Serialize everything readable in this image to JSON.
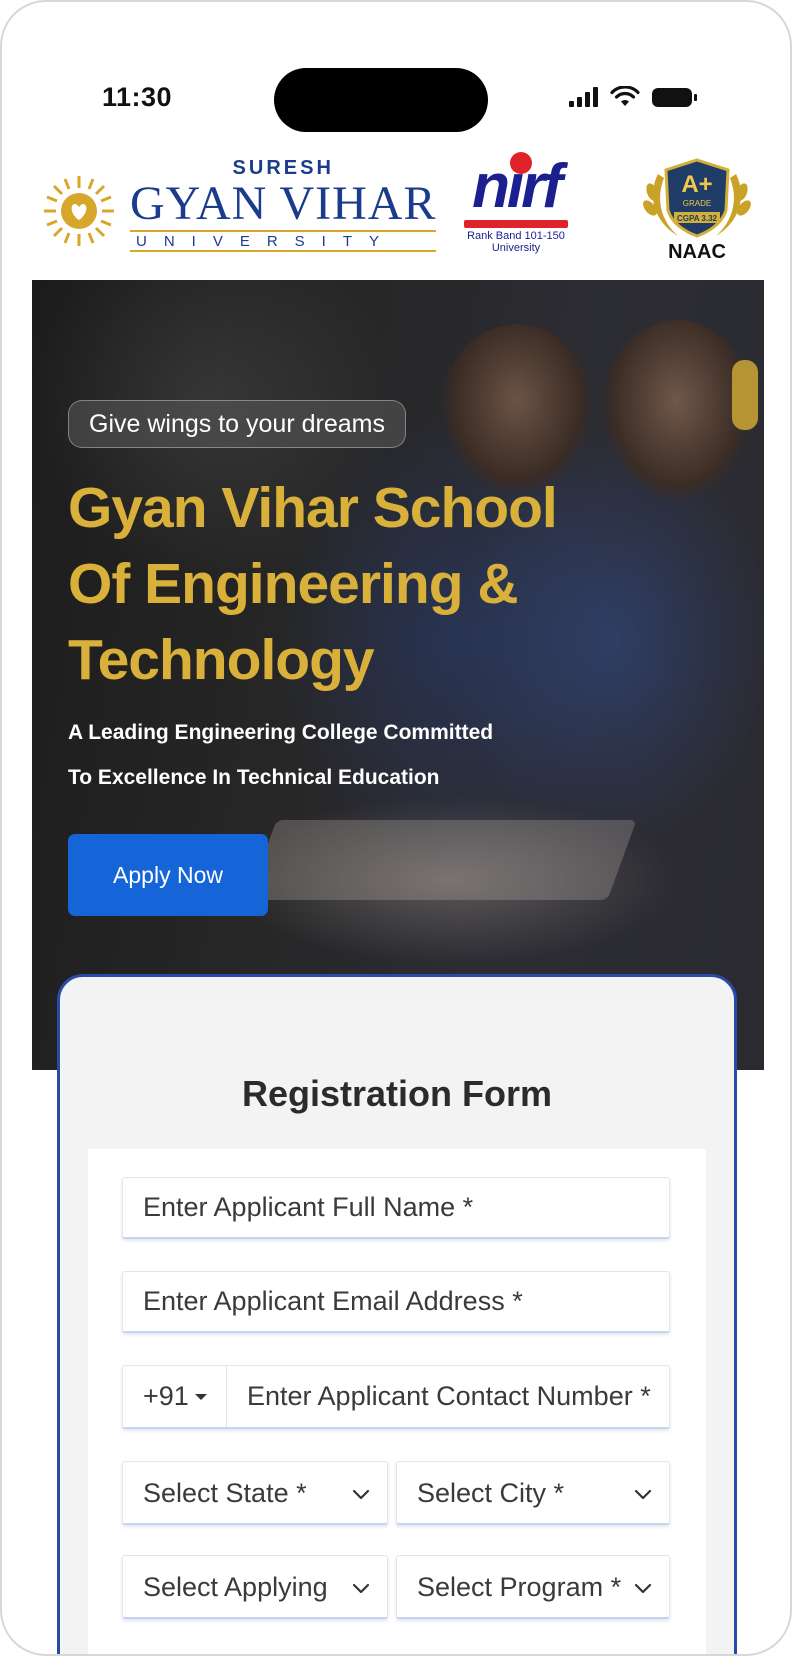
{
  "status": {
    "time": "11:30",
    "icons": [
      "signal-icon",
      "wifi-icon",
      "battery-icon"
    ]
  },
  "logos": {
    "university": {
      "top": "SURESH",
      "name": "GYAN VIHAR",
      "bottom": "UNIVERSITY"
    },
    "nirf": {
      "word": "nirf",
      "rank": "Rank Band 101-150",
      "category": "University"
    },
    "naac": {
      "grade": "A+",
      "grade_word": "GRADE",
      "cgpa": "CGPA 3.32",
      "label": "NAAC"
    }
  },
  "hero": {
    "tag": "Give wings to your dreams",
    "title_lines": [
      "Gyan Vihar School",
      "Of Engineering &",
      "Technology"
    ],
    "subtitle_lines": [
      "A Leading Engineering College Committed",
      "To Excellence In Technical Education"
    ],
    "cta": "Apply Now"
  },
  "form": {
    "title": "Registration Form",
    "name_placeholder": "Enter Applicant Full Name *",
    "email_placeholder": "Enter Applicant Email Address *",
    "country_code": "+91",
    "phone_placeholder": "Enter Applicant Contact Number *",
    "state_placeholder": "Select State *",
    "city_placeholder": "Select City *",
    "level_placeholder": "Select Applying",
    "program_placeholder": "Select Program *"
  },
  "colors": {
    "title_gold": "#d9b13a",
    "cta_blue": "#1565d8",
    "card_border": "#2a4aa6"
  }
}
